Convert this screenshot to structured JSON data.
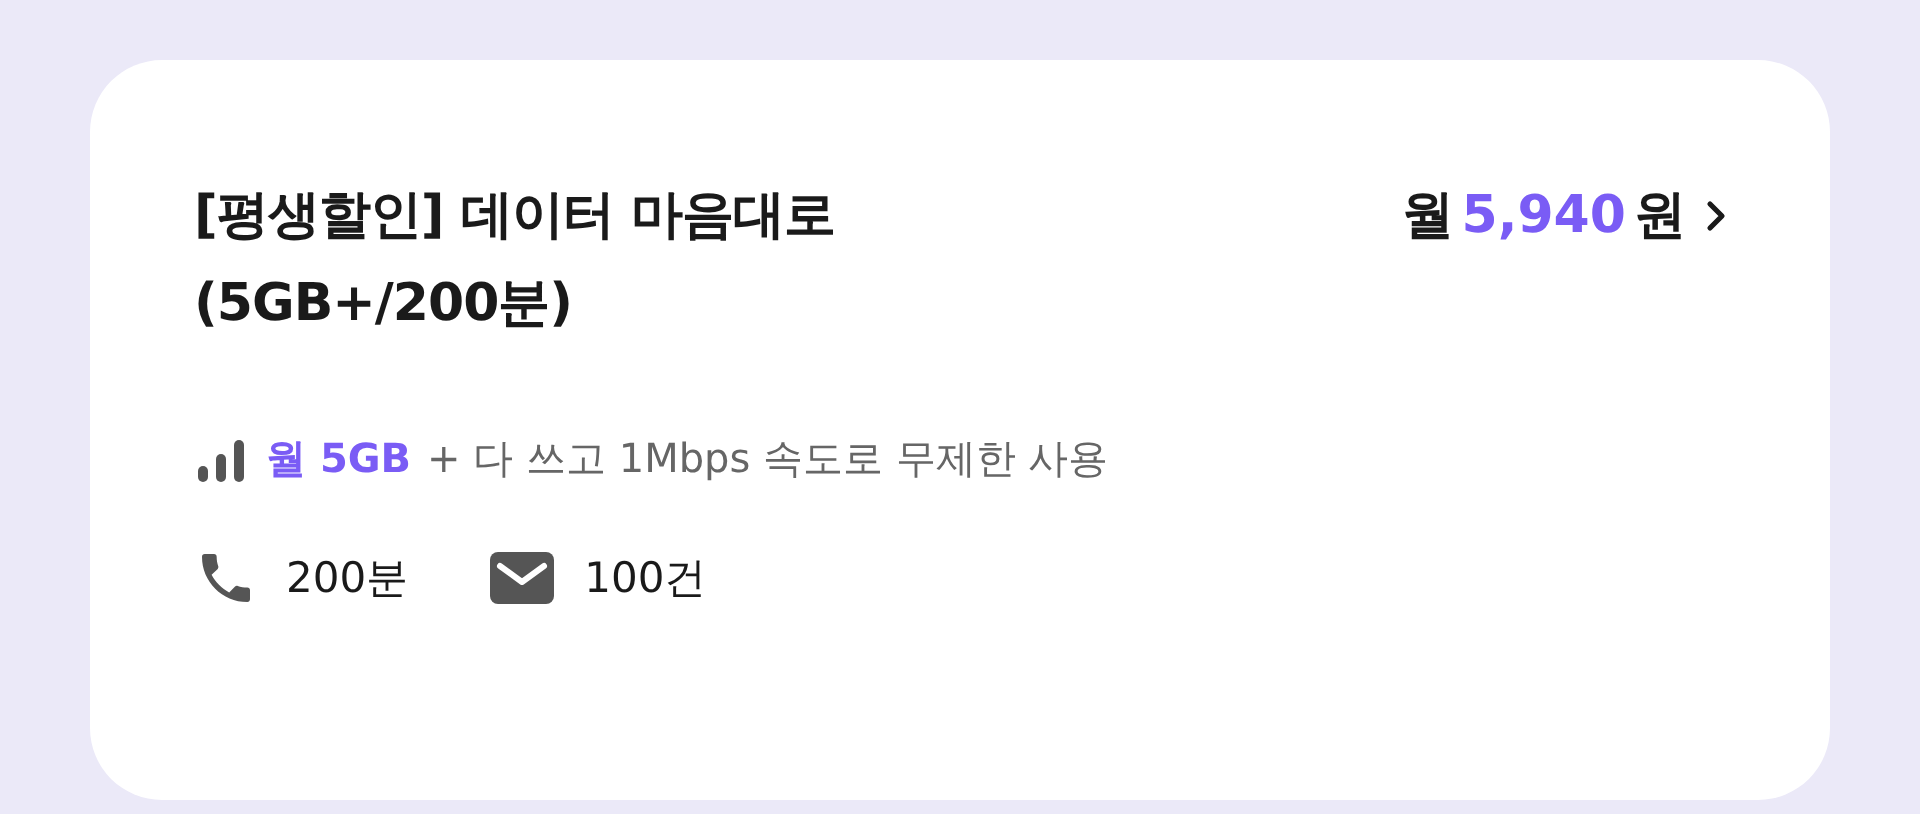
{
  "plan": {
    "title_lines": [
      "[평생할인] 데이터 마음대로",
      "(5GB+/200분)"
    ],
    "price": {
      "prefix": "월",
      "amount": "5,940",
      "suffix": "원"
    },
    "data": {
      "highlight": "월 5GB",
      "detail": "+ 다 쓰고 1Mbps 속도로 무제한 사용"
    },
    "allowances": [
      {
        "kind": "voice",
        "text": "200분"
      },
      {
        "kind": "sms",
        "text": "100건"
      }
    ]
  }
}
